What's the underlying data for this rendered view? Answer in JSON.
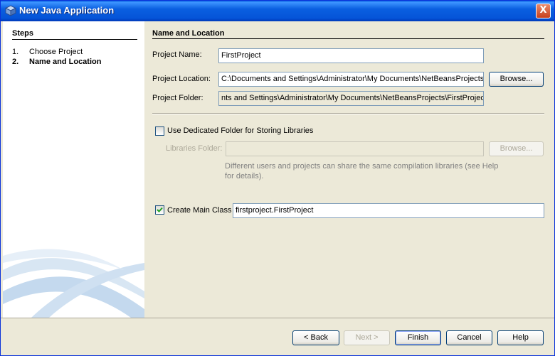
{
  "window": {
    "title": "New Java Application",
    "close_label": "X"
  },
  "steps": {
    "title": "Steps",
    "items": [
      {
        "num": "1.",
        "label": "Choose Project"
      },
      {
        "num": "2.",
        "label": "Name and Location"
      }
    ]
  },
  "main": {
    "section_title": "Name and Location",
    "project_name": {
      "label": "Project Name:",
      "value": "FirstProject"
    },
    "project_location": {
      "label": "Project Location:",
      "value": "C:\\Documents and Settings\\Administrator\\My Documents\\NetBeansProjects",
      "browse_label": "Browse..."
    },
    "project_folder": {
      "label": "Project Folder:",
      "value": "nts and Settings\\Administrator\\My Documents\\NetBeansProjects\\FirstProject"
    },
    "dedicated_folder": {
      "label": "Use Dedicated Folder for Storing Libraries",
      "checked": false
    },
    "libraries_folder": {
      "label": "Libraries Folder:",
      "value": "",
      "browse_label": "Browse..."
    },
    "hint": "Different users and projects can share the same compilation libraries (see Help for details).",
    "main_class": {
      "label": "Create Main Class",
      "checked": true,
      "value": "firstproject.FirstProject"
    }
  },
  "buttons": {
    "back": "< Back",
    "next": "Next >",
    "finish": "Finish",
    "cancel": "Cancel",
    "help": "Help"
  },
  "colors": {
    "title_bar": "#0a5fe0",
    "dialog_bg": "#ece9d8",
    "field_border": "#7f9db9",
    "checkmark": "#21a121"
  }
}
